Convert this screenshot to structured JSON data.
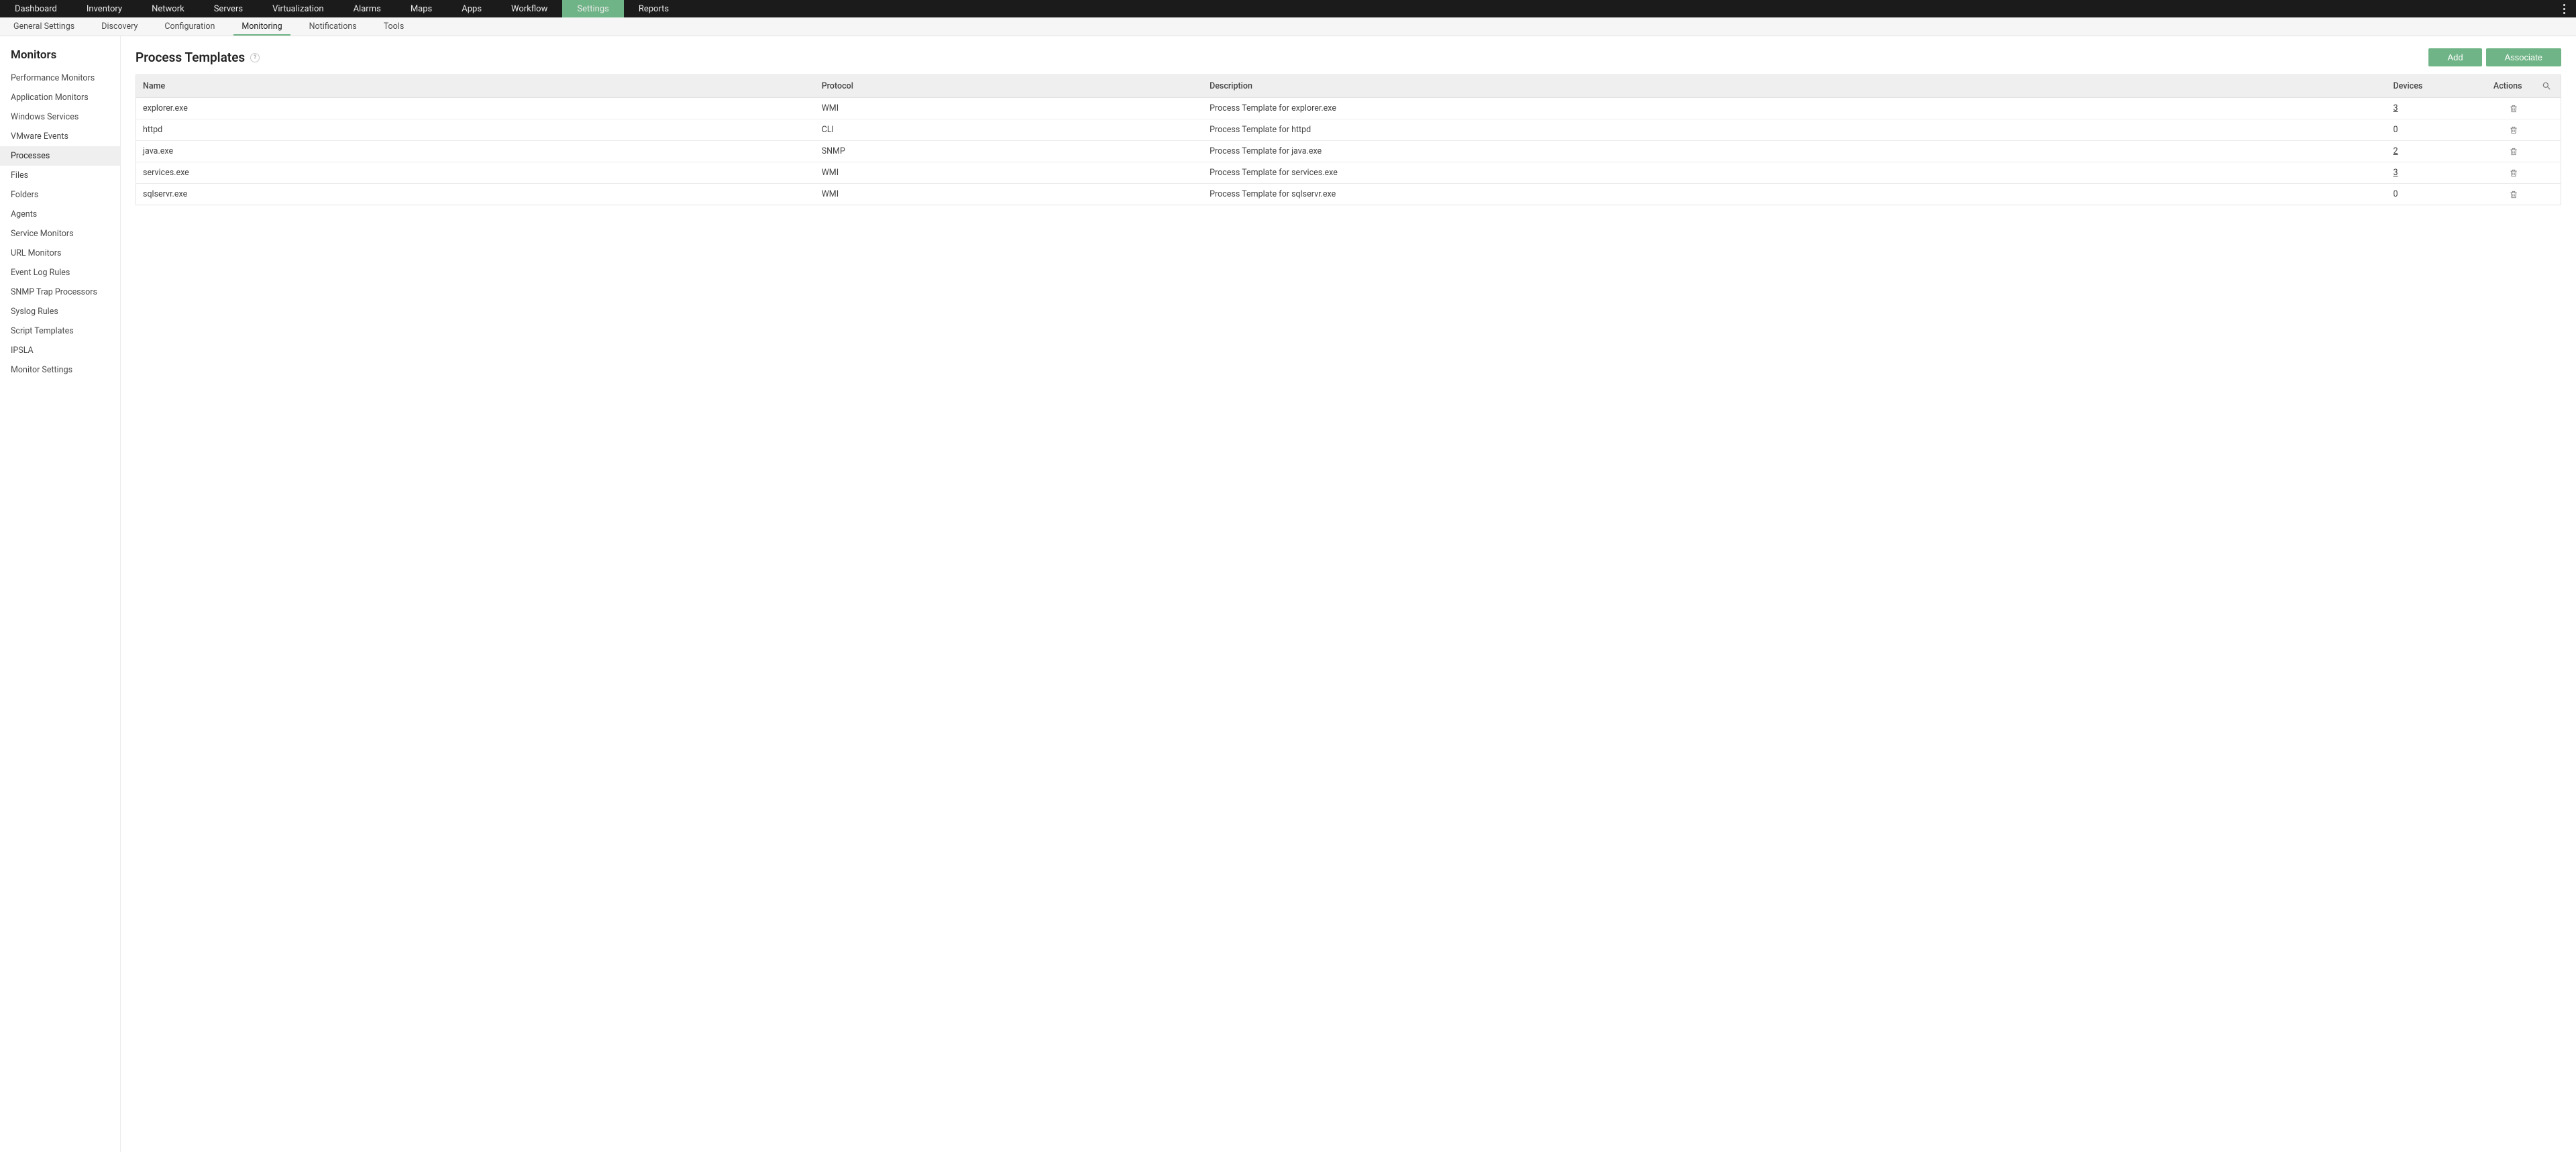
{
  "top_nav": {
    "items": [
      {
        "label": "Dashboard"
      },
      {
        "label": "Inventory"
      },
      {
        "label": "Network"
      },
      {
        "label": "Servers"
      },
      {
        "label": "Virtualization"
      },
      {
        "label": "Alarms"
      },
      {
        "label": "Maps"
      },
      {
        "label": "Apps"
      },
      {
        "label": "Workflow"
      },
      {
        "label": "Settings",
        "active": true
      },
      {
        "label": "Reports"
      }
    ]
  },
  "sub_nav": {
    "items": [
      {
        "label": "General Settings"
      },
      {
        "label": "Discovery"
      },
      {
        "label": "Configuration"
      },
      {
        "label": "Monitoring",
        "active": true
      },
      {
        "label": "Notifications"
      },
      {
        "label": "Tools"
      }
    ]
  },
  "sidebar": {
    "title": "Monitors",
    "items": [
      {
        "label": "Performance Monitors"
      },
      {
        "label": "Application Monitors"
      },
      {
        "label": "Windows Services"
      },
      {
        "label": "VMware Events"
      },
      {
        "label": "Processes",
        "active": true
      },
      {
        "label": "Files"
      },
      {
        "label": "Folders"
      },
      {
        "label": "Agents"
      },
      {
        "label": "Service Monitors"
      },
      {
        "label": "URL Monitors"
      },
      {
        "label": "Event Log Rules"
      },
      {
        "label": "SNMP Trap Processors"
      },
      {
        "label": "Syslog Rules"
      },
      {
        "label": "Script Templates"
      },
      {
        "label": "IPSLA"
      },
      {
        "label": "Monitor Settings"
      }
    ]
  },
  "page": {
    "title": "Process Templates",
    "help": "?",
    "actions": {
      "add": "Add",
      "associate": "Associate"
    }
  },
  "table": {
    "columns": {
      "name": "Name",
      "protocol": "Protocol",
      "description": "Description",
      "devices": "Devices",
      "actions": "Actions"
    },
    "rows": [
      {
        "name": "explorer.exe",
        "protocol": "WMI",
        "description": "Process Template for explorer.exe",
        "devices": "3",
        "devices_link": true
      },
      {
        "name": "httpd",
        "protocol": "CLI",
        "description": "Process Template for httpd",
        "devices": "0",
        "devices_link": false
      },
      {
        "name": "java.exe",
        "protocol": "SNMP",
        "description": "Process Template for java.exe",
        "devices": "2",
        "devices_link": true
      },
      {
        "name": "services.exe",
        "protocol": "WMI",
        "description": "Process Template for services.exe",
        "devices": "3",
        "devices_link": true
      },
      {
        "name": "sqlservr.exe",
        "protocol": "WMI",
        "description": "Process Template for sqlservr.exe",
        "devices": "0",
        "devices_link": false
      }
    ]
  }
}
